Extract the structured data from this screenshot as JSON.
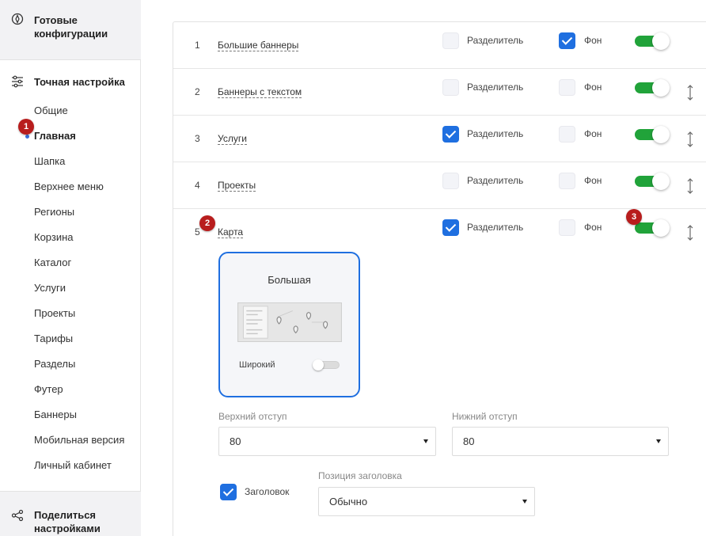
{
  "sidebar": {
    "top_section": {
      "label": "Готовые конфигурации",
      "icon": "compass-icon"
    },
    "fine_tune": {
      "label": "Точная настройка",
      "icon": "sliders-icon"
    },
    "items": [
      {
        "label": "Общие"
      },
      {
        "label": "Главная",
        "active": true
      },
      {
        "label": "Шапка"
      },
      {
        "label": "Верхнее меню"
      },
      {
        "label": "Регионы"
      },
      {
        "label": "Корзина"
      },
      {
        "label": "Каталог"
      },
      {
        "label": "Услуги"
      },
      {
        "label": "Проекты"
      },
      {
        "label": "Тарифы"
      },
      {
        "label": "Разделы"
      },
      {
        "label": "Футер"
      },
      {
        "label": "Баннеры"
      },
      {
        "label": "Мобильная версия"
      },
      {
        "label": "Личный кабинет"
      }
    ],
    "share": {
      "label": "Поделиться настройками",
      "icon": "share-icon"
    }
  },
  "badges": {
    "b1": "1",
    "b2": "2",
    "b3": "3"
  },
  "rows": [
    {
      "num": "1",
      "title": "Большие баннеры",
      "divider_label": "Разделитель",
      "divider_checked": false,
      "bg_label": "Фон",
      "bg_checked": true,
      "enabled": true
    },
    {
      "num": "2",
      "title": "Баннеры с текстом",
      "divider_label": "Разделитель",
      "divider_checked": false,
      "bg_label": "Фон",
      "bg_checked": false,
      "enabled": true
    },
    {
      "num": "3",
      "title": "Услуги",
      "divider_label": "Разделитель",
      "divider_checked": true,
      "bg_label": "Фон",
      "bg_checked": false,
      "enabled": true
    },
    {
      "num": "4",
      "title": "Проекты",
      "divider_label": "Разделитель",
      "divider_checked": false,
      "bg_label": "Фон",
      "bg_checked": false,
      "enabled": true
    },
    {
      "num": "5",
      "title": "Карта",
      "divider_label": "Разделитель",
      "divider_checked": true,
      "bg_label": "Фон",
      "bg_checked": false,
      "enabled": true
    }
  ],
  "map_settings": {
    "variant_title": "Большая",
    "wide_label": "Широкий",
    "wide_enabled": false,
    "top_padding_label": "Верхний отступ",
    "top_padding_value": "80",
    "bottom_padding_label": "Нижний отступ",
    "bottom_padding_value": "80",
    "heading_label": "Заголовок",
    "heading_checked": true,
    "heading_position_label": "Позиция заголовка",
    "heading_position_value": "Обычно"
  },
  "colors": {
    "accent": "#1f6fe0",
    "toggle_on": "#21a33a",
    "badge": "#b81d1d",
    "sidebar_bg": "#f2f2f4"
  }
}
